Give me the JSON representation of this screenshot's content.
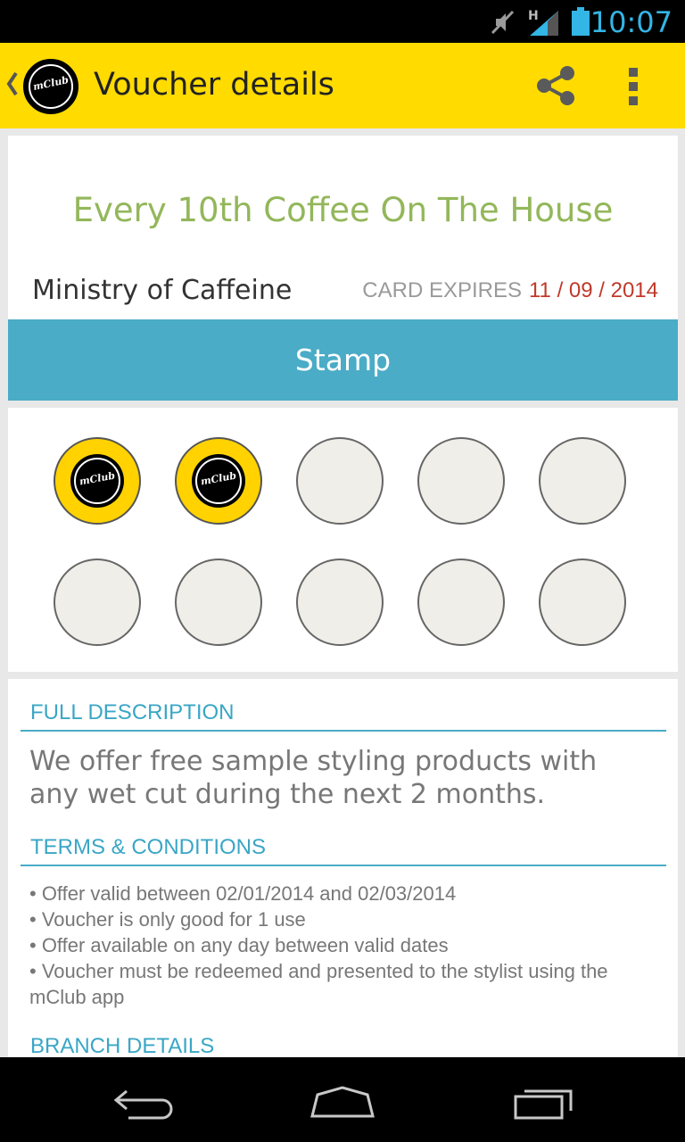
{
  "status_bar": {
    "time": "10:07",
    "network": "H",
    "icons": [
      "mute-icon",
      "signal-icon",
      "battery-icon"
    ],
    "accent": "#33b5e5"
  },
  "action_bar": {
    "title": "Voucher details",
    "logo_text": "mClub",
    "icons": [
      "back-chevron-icon",
      "share-icon",
      "overflow-menu-icon"
    ],
    "color": "#ffdb00"
  },
  "voucher": {
    "title": "Every 10th Coffee On The House",
    "merchant": "Ministry of Caffeine",
    "expires_label": "CARD EXPIRES",
    "expires_date": "11 / 09 / 2014",
    "stamp_button": "Stamp",
    "stamps_total": 10,
    "stamps_collected": 2,
    "stamp_logo_text": "mClub"
  },
  "details": {
    "full_description_heading": "FULL DESCRIPTION",
    "full_description": "We offer free sample styling products with any wet cut during the next 2 months.",
    "terms_heading": "TERMS & CONDITIONS",
    "terms": [
      "• Offer valid between 02/01/2014 and 02/03/2014",
      "• Voucher is only good for 1 use",
      "• Offer available on any day between valid dates",
      "• Voucher must be redeemed and presented to the stylist using the mClub app"
    ],
    "branch_heading": "BRANCH DETAILS"
  },
  "nav_bar": {
    "icons": [
      "back-icon",
      "home-icon",
      "recents-icon"
    ]
  },
  "colors": {
    "title_green": "#93b75a",
    "stamp_button": "#4aacc7",
    "expiry_red": "#c0392b",
    "stamp_fill": "#ffd200"
  }
}
